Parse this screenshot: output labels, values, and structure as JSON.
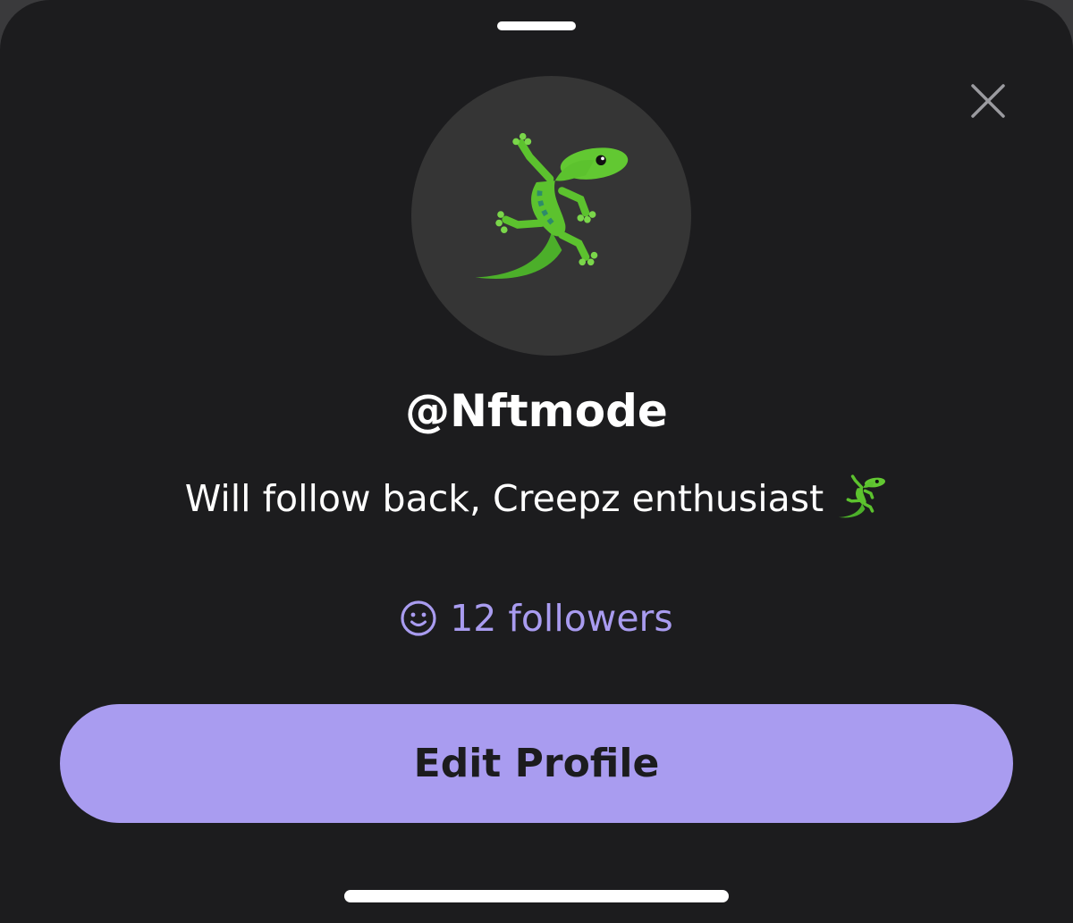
{
  "profile": {
    "username": "@Nftmode",
    "bio": "Will follow back, Creepz enthusiast",
    "bio_emoji_icon": "lizard-icon",
    "avatar_icon": "lizard-icon",
    "followers_icon": "smiley-face-icon",
    "followers_label": "12 followers"
  },
  "actions": {
    "close_icon": "close-icon",
    "edit_profile_label": "Edit Profile"
  },
  "colors": {
    "sheet_background": "#1c1c1e",
    "avatar_background": "#353535",
    "accent": "#a99cf0",
    "text_primary": "#ffffff"
  }
}
